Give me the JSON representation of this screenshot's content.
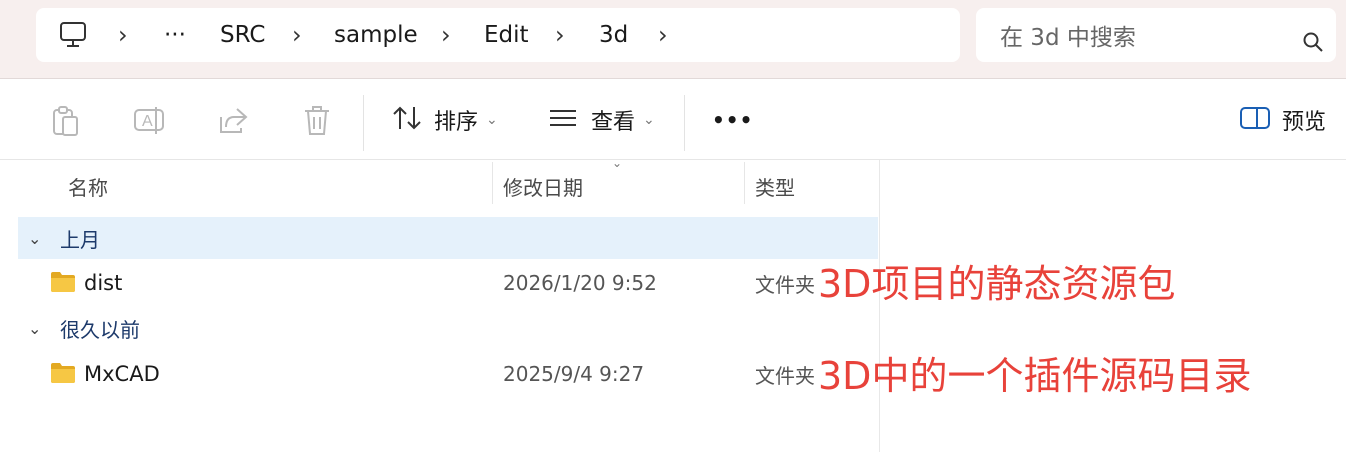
{
  "breadcrumb": {
    "items": [
      "SRC",
      "sample",
      "Edit",
      "3d"
    ],
    "ellipsis": "···"
  },
  "search": {
    "placeholder": "在 3d 中搜索"
  },
  "toolbar": {
    "sort_label": "排序",
    "view_label": "查看",
    "more_label": "•••",
    "preview_label": "预览"
  },
  "columns": {
    "name": "名称",
    "modified": "修改日期",
    "type": "类型"
  },
  "groups": [
    {
      "label": "上月",
      "files": [
        {
          "name": "dist",
          "modified": "2026/1/20 9:52",
          "type": "文件夹"
        }
      ]
    },
    {
      "label": "很久以前",
      "files": [
        {
          "name": "MxCAD",
          "modified": "2025/9/4 9:27",
          "type": "文件夹"
        }
      ]
    }
  ],
  "annotations": [
    "3D项目的静态资源包",
    "3D中的一个插件源码目录"
  ],
  "colors": {
    "annotation": "#e8423a",
    "selection": "#e5f1fb",
    "folder": "#f4c542"
  }
}
